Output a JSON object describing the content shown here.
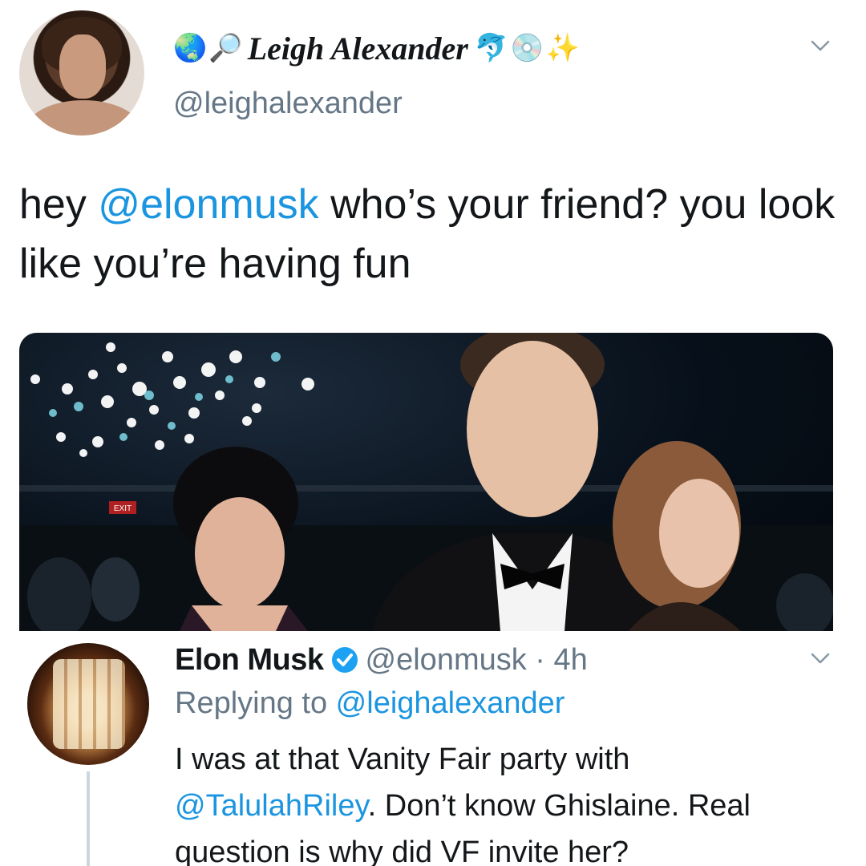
{
  "main_tweet": {
    "display_name_prefix_emojis": [
      "🌏",
      "🔎"
    ],
    "display_name": "Leigh Alexander",
    "display_name_suffix_emojis": [
      "🐬",
      "💿",
      "✨"
    ],
    "handle": "@leighalexander",
    "text_before": "hey ",
    "mention": "@elonmusk",
    "text_after": " who’s your friend? you look like you’re having fun",
    "media_sign": "EXIT"
  },
  "reply_tweet": {
    "display_name": "Elon Musk",
    "handle": "@elonmusk",
    "time": "4h",
    "replying_prefix": "Replying to ",
    "replying_handle": "@leighalexander",
    "text_line1": "I was at that Vanity Fair party with",
    "text_mention": "@TalulahRiley",
    "text_rest": ". Don’t know Ghislaine. Real question is why did VF invite her?"
  },
  "colors": {
    "link": "#1b95e0",
    "secondary_text": "#657786",
    "verified_badge": "#1da1f2",
    "primary_text": "#14171a"
  },
  "icons": [
    "chevron-down-icon",
    "verified-badge-icon"
  ]
}
